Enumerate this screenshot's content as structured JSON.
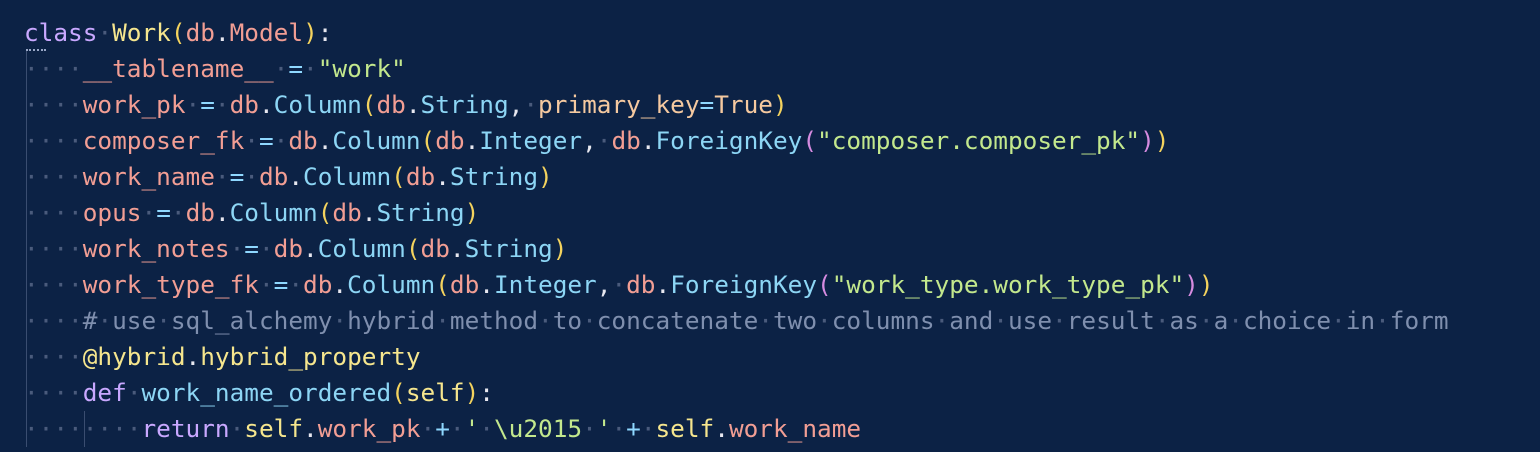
{
  "editor": {
    "language": "python",
    "theme_colors": {
      "background": "#0c2245",
      "keyword": "#c9a8ff",
      "class_name": "#f6e68e",
      "identifier": "#f29e94",
      "attribute": "#8dd6f5",
      "string": "#c3e88d",
      "comment": "#7f8fae",
      "whitespace_dot": "#4a5b7c"
    },
    "lines": [
      {
        "indent": 0,
        "tokens": [
          {
            "t": "kw",
            "v": "class"
          },
          {
            "t": "ws",
            "v": "·"
          },
          {
            "t": "cls",
            "v": "Work"
          },
          {
            "t": "paren1",
            "v": "("
          },
          {
            "t": "ident",
            "v": "db"
          },
          {
            "t": "punc",
            "v": "."
          },
          {
            "t": "ident",
            "v": "Model"
          },
          {
            "t": "paren1",
            "v": ")"
          },
          {
            "t": "punc",
            "v": ":"
          }
        ]
      },
      {
        "indent": 1,
        "tokens": [
          {
            "t": "ident",
            "v": "__tablename__"
          },
          {
            "t": "ws",
            "v": "·"
          },
          {
            "t": "op",
            "v": "="
          },
          {
            "t": "ws",
            "v": "·"
          },
          {
            "t": "str",
            "v": "\"work\""
          }
        ]
      },
      {
        "indent": 1,
        "tokens": [
          {
            "t": "ident",
            "v": "work_pk"
          },
          {
            "t": "ws",
            "v": "·"
          },
          {
            "t": "op",
            "v": "="
          },
          {
            "t": "ws",
            "v": "·"
          },
          {
            "t": "ident",
            "v": "db"
          },
          {
            "t": "punc",
            "v": "."
          },
          {
            "t": "attr",
            "v": "Column"
          },
          {
            "t": "paren1",
            "v": "("
          },
          {
            "t": "ident",
            "v": "db"
          },
          {
            "t": "punc",
            "v": "."
          },
          {
            "t": "attr",
            "v": "String"
          },
          {
            "t": "punc",
            "v": ","
          },
          {
            "t": "ws",
            "v": "·"
          },
          {
            "t": "param",
            "v": "primary_key"
          },
          {
            "t": "op",
            "v": "="
          },
          {
            "t": "const",
            "v": "True"
          },
          {
            "t": "paren1",
            "v": ")"
          }
        ]
      },
      {
        "indent": 1,
        "tokens": [
          {
            "t": "ident",
            "v": "composer_fk"
          },
          {
            "t": "ws",
            "v": "·"
          },
          {
            "t": "op",
            "v": "="
          },
          {
            "t": "ws",
            "v": "·"
          },
          {
            "t": "ident",
            "v": "db"
          },
          {
            "t": "punc",
            "v": "."
          },
          {
            "t": "attr",
            "v": "Column"
          },
          {
            "t": "paren1",
            "v": "("
          },
          {
            "t": "ident",
            "v": "db"
          },
          {
            "t": "punc",
            "v": "."
          },
          {
            "t": "attr",
            "v": "Integer"
          },
          {
            "t": "punc",
            "v": ","
          },
          {
            "t": "ws",
            "v": "·"
          },
          {
            "t": "ident",
            "v": "db"
          },
          {
            "t": "punc",
            "v": "."
          },
          {
            "t": "attr",
            "v": "ForeignKey"
          },
          {
            "t": "paren2",
            "v": "("
          },
          {
            "t": "str",
            "v": "\"composer.composer_pk\""
          },
          {
            "t": "paren2",
            "v": ")"
          },
          {
            "t": "paren1",
            "v": ")"
          }
        ]
      },
      {
        "indent": 1,
        "tokens": [
          {
            "t": "ident",
            "v": "work_name"
          },
          {
            "t": "ws",
            "v": "·"
          },
          {
            "t": "op",
            "v": "="
          },
          {
            "t": "ws",
            "v": "·"
          },
          {
            "t": "ident",
            "v": "db"
          },
          {
            "t": "punc",
            "v": "."
          },
          {
            "t": "attr",
            "v": "Column"
          },
          {
            "t": "paren1",
            "v": "("
          },
          {
            "t": "ident",
            "v": "db"
          },
          {
            "t": "punc",
            "v": "."
          },
          {
            "t": "attr",
            "v": "String"
          },
          {
            "t": "paren1",
            "v": ")"
          }
        ]
      },
      {
        "indent": 1,
        "tokens": [
          {
            "t": "ident",
            "v": "opus"
          },
          {
            "t": "ws",
            "v": "·"
          },
          {
            "t": "op",
            "v": "="
          },
          {
            "t": "ws",
            "v": "·"
          },
          {
            "t": "ident",
            "v": "db"
          },
          {
            "t": "punc",
            "v": "."
          },
          {
            "t": "attr",
            "v": "Column"
          },
          {
            "t": "paren1",
            "v": "("
          },
          {
            "t": "ident",
            "v": "db"
          },
          {
            "t": "punc",
            "v": "."
          },
          {
            "t": "attr",
            "v": "String"
          },
          {
            "t": "paren1",
            "v": ")"
          }
        ]
      },
      {
        "indent": 1,
        "tokens": [
          {
            "t": "ident",
            "v": "work_notes"
          },
          {
            "t": "ws",
            "v": "·"
          },
          {
            "t": "op",
            "v": "="
          },
          {
            "t": "ws",
            "v": "·"
          },
          {
            "t": "ident",
            "v": "db"
          },
          {
            "t": "punc",
            "v": "."
          },
          {
            "t": "attr",
            "v": "Column"
          },
          {
            "t": "paren1",
            "v": "("
          },
          {
            "t": "ident",
            "v": "db"
          },
          {
            "t": "punc",
            "v": "."
          },
          {
            "t": "attr",
            "v": "String"
          },
          {
            "t": "paren1",
            "v": ")"
          }
        ]
      },
      {
        "indent": 1,
        "tokens": [
          {
            "t": "ident",
            "v": "work_type_fk"
          },
          {
            "t": "ws",
            "v": "·"
          },
          {
            "t": "op",
            "v": "="
          },
          {
            "t": "ws",
            "v": "·"
          },
          {
            "t": "ident",
            "v": "db"
          },
          {
            "t": "punc",
            "v": "."
          },
          {
            "t": "attr",
            "v": "Column"
          },
          {
            "t": "paren1",
            "v": "("
          },
          {
            "t": "ident",
            "v": "db"
          },
          {
            "t": "punc",
            "v": "."
          },
          {
            "t": "attr",
            "v": "Integer"
          },
          {
            "t": "punc",
            "v": ","
          },
          {
            "t": "ws",
            "v": "·"
          },
          {
            "t": "ident",
            "v": "db"
          },
          {
            "t": "punc",
            "v": "."
          },
          {
            "t": "attr",
            "v": "ForeignKey"
          },
          {
            "t": "paren2",
            "v": "("
          },
          {
            "t": "str",
            "v": "\"work_type.work_type_pk\""
          },
          {
            "t": "paren2",
            "v": ")"
          },
          {
            "t": "paren1",
            "v": ")"
          }
        ]
      },
      {
        "indent": 1,
        "tokens": [
          {
            "t": "cmt",
            "v": "#"
          },
          {
            "t": "ws",
            "v": "·"
          },
          {
            "t": "cmt",
            "v": "use"
          },
          {
            "t": "ws",
            "v": "·"
          },
          {
            "t": "cmt",
            "v": "sql_alchemy"
          },
          {
            "t": "ws",
            "v": "·"
          },
          {
            "t": "cmt",
            "v": "hybrid"
          },
          {
            "t": "ws",
            "v": "·"
          },
          {
            "t": "cmt",
            "v": "method"
          },
          {
            "t": "ws",
            "v": "·"
          },
          {
            "t": "cmt",
            "v": "to"
          },
          {
            "t": "ws",
            "v": "·"
          },
          {
            "t": "cmt",
            "v": "concatenate"
          },
          {
            "t": "ws",
            "v": "·"
          },
          {
            "t": "cmt",
            "v": "two"
          },
          {
            "t": "ws",
            "v": "·"
          },
          {
            "t": "cmt",
            "v": "columns"
          },
          {
            "t": "ws",
            "v": "·"
          },
          {
            "t": "cmt",
            "v": "and"
          },
          {
            "t": "ws",
            "v": "·"
          },
          {
            "t": "cmt",
            "v": "use"
          },
          {
            "t": "ws",
            "v": "·"
          },
          {
            "t": "cmt",
            "v": "result"
          },
          {
            "t": "ws",
            "v": "·"
          },
          {
            "t": "cmt",
            "v": "as"
          },
          {
            "t": "ws",
            "v": "·"
          },
          {
            "t": "cmt",
            "v": "a"
          },
          {
            "t": "ws",
            "v": "·"
          },
          {
            "t": "cmt",
            "v": "choice"
          },
          {
            "t": "ws",
            "v": "·"
          },
          {
            "t": "cmt",
            "v": "in"
          },
          {
            "t": "ws",
            "v": "·"
          },
          {
            "t": "cmt",
            "v": "form"
          }
        ]
      },
      {
        "indent": 1,
        "tokens": [
          {
            "t": "deco",
            "v": "@hybrid"
          },
          {
            "t": "punc",
            "v": "."
          },
          {
            "t": "deco",
            "v": "hybrid_property"
          }
        ]
      },
      {
        "indent": 1,
        "tokens": [
          {
            "t": "kw",
            "v": "def"
          },
          {
            "t": "ws",
            "v": "·"
          },
          {
            "t": "attr",
            "v": "work_name_ordered"
          },
          {
            "t": "paren1",
            "v": "("
          },
          {
            "t": "self",
            "v": "self"
          },
          {
            "t": "paren1",
            "v": ")"
          },
          {
            "t": "punc",
            "v": ":"
          }
        ]
      },
      {
        "indent": 2,
        "tokens": [
          {
            "t": "kw",
            "v": "return"
          },
          {
            "t": "ws",
            "v": "·"
          },
          {
            "t": "self",
            "v": "self"
          },
          {
            "t": "punc",
            "v": "."
          },
          {
            "t": "ident",
            "v": "work_pk"
          },
          {
            "t": "ws",
            "v": "·"
          },
          {
            "t": "op",
            "v": "+"
          },
          {
            "t": "ws",
            "v": "·"
          },
          {
            "t": "str",
            "v": "'"
          },
          {
            "t": "ws",
            "v": "·"
          },
          {
            "t": "str",
            "v": "\\u2015"
          },
          {
            "t": "ws",
            "v": "·"
          },
          {
            "t": "str",
            "v": "'"
          },
          {
            "t": "ws",
            "v": "·"
          },
          {
            "t": "op",
            "v": "+"
          },
          {
            "t": "ws",
            "v": "·"
          },
          {
            "t": "self",
            "v": "self"
          },
          {
            "t": "punc",
            "v": "."
          },
          {
            "t": "ident",
            "v": "work_name"
          }
        ]
      }
    ]
  }
}
